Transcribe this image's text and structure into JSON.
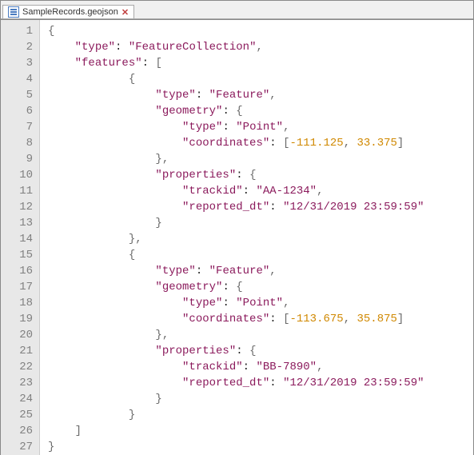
{
  "tab": {
    "filename": "SampleRecords.geojson"
  },
  "source": {
    "type": "FeatureCollection",
    "features": [
      {
        "type": "Feature",
        "geometry": {
          "type": "Point",
          "coordinates": [
            -111.125,
            33.375
          ]
        },
        "properties": {
          "trackid": "AA-1234",
          "reported_dt": "12/31/2019 23:59:59"
        }
      },
      {
        "type": "Feature",
        "geometry": {
          "type": "Point",
          "coordinates": [
            -113.675,
            35.875
          ]
        },
        "properties": {
          "trackid": "BB-7890",
          "reported_dt": "12/31/2019 23:59:59"
        }
      }
    ]
  },
  "tokens": [
    [
      [
        "p",
        "{"
      ]
    ],
    [
      [
        "w",
        "    "
      ],
      [
        "k",
        "\"type\""
      ],
      [
        "c",
        ": "
      ],
      [
        "s",
        "\"FeatureCollection\""
      ],
      [
        "p",
        ","
      ]
    ],
    [
      [
        "w",
        "    "
      ],
      [
        "k",
        "\"features\""
      ],
      [
        "c",
        ": "
      ],
      [
        "p",
        "["
      ]
    ],
    [
      [
        "w",
        "            "
      ],
      [
        "p",
        "{"
      ]
    ],
    [
      [
        "w",
        "                "
      ],
      [
        "k",
        "\"type\""
      ],
      [
        "c",
        ": "
      ],
      [
        "s",
        "\"Feature\""
      ],
      [
        "p",
        ","
      ]
    ],
    [
      [
        "w",
        "                "
      ],
      [
        "k",
        "\"geometry\""
      ],
      [
        "c",
        ": "
      ],
      [
        "p",
        "{"
      ]
    ],
    [
      [
        "w",
        "                    "
      ],
      [
        "k",
        "\"type\""
      ],
      [
        "c",
        ": "
      ],
      [
        "s",
        "\"Point\""
      ],
      [
        "p",
        ","
      ]
    ],
    [
      [
        "w",
        "                    "
      ],
      [
        "k",
        "\"coordinates\""
      ],
      [
        "c",
        ": "
      ],
      [
        "p",
        "["
      ],
      [
        "n",
        "-111.125"
      ],
      [
        "p",
        ", "
      ],
      [
        "n",
        "33.375"
      ],
      [
        "p",
        "]"
      ]
    ],
    [
      [
        "w",
        "                "
      ],
      [
        "p",
        "},"
      ]
    ],
    [
      [
        "w",
        "                "
      ],
      [
        "k",
        "\"properties\""
      ],
      [
        "c",
        ": "
      ],
      [
        "p",
        "{"
      ]
    ],
    [
      [
        "w",
        "                    "
      ],
      [
        "k",
        "\"trackid\""
      ],
      [
        "c",
        ": "
      ],
      [
        "s",
        "\"AA-1234\""
      ],
      [
        "p",
        ","
      ]
    ],
    [
      [
        "w",
        "                    "
      ],
      [
        "k",
        "\"reported_dt\""
      ],
      [
        "c",
        ": "
      ],
      [
        "s",
        "\"12/31/2019 23:59:59\""
      ]
    ],
    [
      [
        "w",
        "                "
      ],
      [
        "p",
        "}"
      ]
    ],
    [
      [
        "w",
        "            "
      ],
      [
        "p",
        "},"
      ]
    ],
    [
      [
        "w",
        "            "
      ],
      [
        "p",
        "{"
      ]
    ],
    [
      [
        "w",
        "                "
      ],
      [
        "k",
        "\"type\""
      ],
      [
        "c",
        ": "
      ],
      [
        "s",
        "\"Feature\""
      ],
      [
        "p",
        ","
      ]
    ],
    [
      [
        "w",
        "                "
      ],
      [
        "k",
        "\"geometry\""
      ],
      [
        "c",
        ": "
      ],
      [
        "p",
        "{"
      ]
    ],
    [
      [
        "w",
        "                    "
      ],
      [
        "k",
        "\"type\""
      ],
      [
        "c",
        ": "
      ],
      [
        "s",
        "\"Point\""
      ],
      [
        "p",
        ","
      ]
    ],
    [
      [
        "w",
        "                    "
      ],
      [
        "k",
        "\"coordinates\""
      ],
      [
        "c",
        ": "
      ],
      [
        "p",
        "["
      ],
      [
        "n",
        "-113.675"
      ],
      [
        "p",
        ", "
      ],
      [
        "n",
        "35.875"
      ],
      [
        "p",
        "]"
      ]
    ],
    [
      [
        "w",
        "                "
      ],
      [
        "p",
        "},"
      ]
    ],
    [
      [
        "w",
        "                "
      ],
      [
        "k",
        "\"properties\""
      ],
      [
        "c",
        ": "
      ],
      [
        "p",
        "{"
      ]
    ],
    [
      [
        "w",
        "                    "
      ],
      [
        "k",
        "\"trackid\""
      ],
      [
        "c",
        ": "
      ],
      [
        "s",
        "\"BB-7890\""
      ],
      [
        "p",
        ","
      ]
    ],
    [
      [
        "w",
        "                    "
      ],
      [
        "k",
        "\"reported_dt\""
      ],
      [
        "c",
        ": "
      ],
      [
        "s",
        "\"12/31/2019 23:59:59\""
      ]
    ],
    [
      [
        "w",
        "                "
      ],
      [
        "p",
        "}"
      ]
    ],
    [
      [
        "w",
        "            "
      ],
      [
        "p",
        "}"
      ]
    ],
    [
      [
        "w",
        "    "
      ],
      [
        "p",
        "]"
      ]
    ],
    [
      [
        "p",
        "}"
      ]
    ]
  ]
}
